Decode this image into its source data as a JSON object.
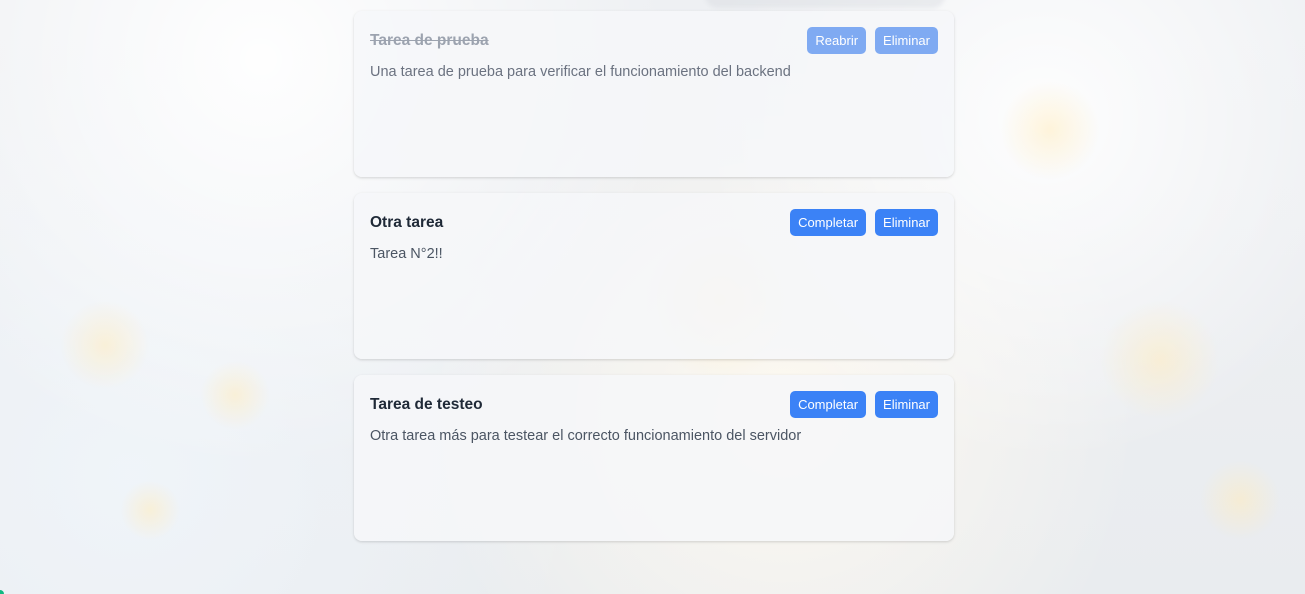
{
  "tasks": [
    {
      "title": "Tarea de prueba",
      "description": "Una tarea de prueba para verificar el funcionamiento del backend",
      "completed": true,
      "primary_action": "Reabrir",
      "delete_action": "Eliminar"
    },
    {
      "title": "Otra tarea",
      "description": "Tarea N°2!!",
      "completed": false,
      "primary_action": "Completar",
      "delete_action": "Eliminar"
    },
    {
      "title": "Tarea de testeo",
      "description": "Otra tarea más para testear el correcto funcionamiento del servidor",
      "completed": false,
      "primary_action": "Completar",
      "delete_action": "Eliminar"
    }
  ],
  "colors": {
    "button_primary": "#3b82f6",
    "button_faded": "#7faaf2",
    "title_text": "#1f2937",
    "completed_title": "#9ca3af",
    "description_text": "#4b5563"
  }
}
